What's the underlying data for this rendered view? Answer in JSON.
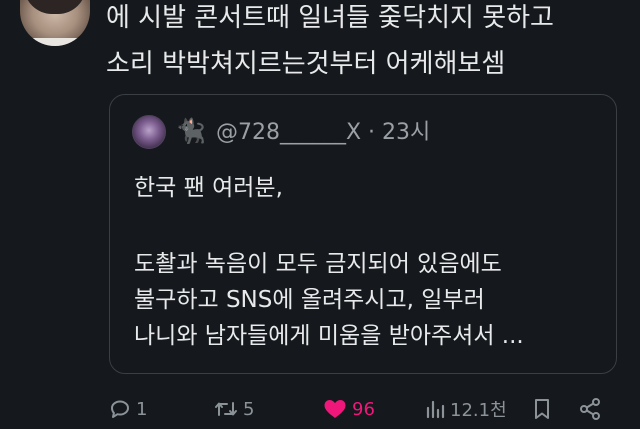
{
  "tweet": {
    "line1": "에 시발 콘서트때 일녀들 줒닥치지 못하고",
    "line2": "소리 박박쳐지르는것부터 어케해보셈"
  },
  "quote": {
    "emoji": "🐈‍⬛",
    "handle": "@728______X · 23시",
    "line1": "한국 팬 여러분,",
    "line2": " 도촬과 녹음이 모두 금지되어 있음에도",
    "line3": "불구하고 SNS에 올려주시고, 일부러",
    "line4": "나니와 남자들에게 미움을 받아주셔서 ..."
  },
  "actions": {
    "reply_count": "1",
    "retweet_count": "5",
    "like_count": "96",
    "views_count": "12.1천"
  },
  "colors": {
    "background": "#15181c",
    "text": "#e7e9ea",
    "muted": "#8b9399",
    "like": "#f0177a",
    "border": "#3a3f45"
  },
  "icons": {
    "reply": "reply-icon",
    "retweet": "retweet-icon",
    "like": "heart-icon",
    "views": "views-icon",
    "bookmark": "bookmark-icon",
    "share": "share-icon"
  }
}
